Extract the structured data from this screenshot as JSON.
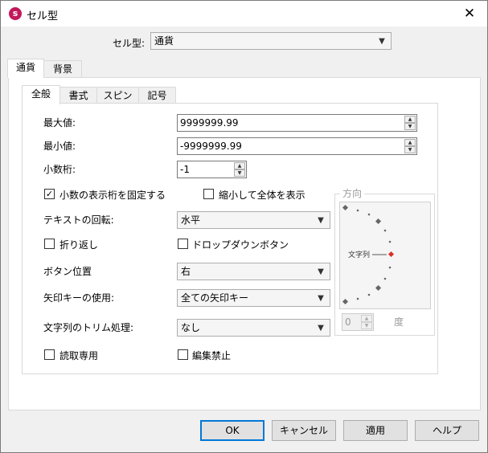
{
  "title": "セル型",
  "colors": {
    "accent": "#0078d7",
    "app_icon": "#c2185b",
    "marker_red": "#d93025"
  },
  "cell_type": {
    "label": "セル型:",
    "value": "通貨"
  },
  "outer_tabs": [
    {
      "label": "通貨"
    },
    {
      "label": "背景"
    }
  ],
  "inner_tabs": [
    {
      "label": "全般"
    },
    {
      "label": "書式"
    },
    {
      "label": "スピン"
    },
    {
      "label": "記号"
    }
  ],
  "fields": {
    "max_label": "最大値:",
    "max_value": "9999999.99",
    "min_label": "最小値:",
    "min_value": "-9999999.99",
    "decimal_label": "小数桁:",
    "decimal_value": "-1"
  },
  "checks": {
    "fixed_decimal": {
      "label": "小数の表示桁を固定する",
      "checked": true
    },
    "shrink_to_fit": {
      "label": "縮小して全体を表示",
      "checked": false
    },
    "wrap": {
      "label": "折り返し",
      "checked": false
    },
    "dropdown_button": {
      "label": "ドロップダウンボタン",
      "checked": false
    },
    "read_only": {
      "label": "読取専用",
      "checked": false
    },
    "edit_lock": {
      "label": "編集禁止",
      "checked": false
    }
  },
  "selects": {
    "rotation_label": "テキストの回転:",
    "rotation_value": "水平",
    "button_pos_label": "ボタン位置",
    "button_pos_value": "右",
    "arrow_keys_label": "矢印キーの使用:",
    "arrow_keys_value": "全ての矢印キー",
    "trim_label": "文字列のトリム処理:",
    "trim_value": "なし"
  },
  "orientation": {
    "group_label": "方向",
    "text_label": "文字列",
    "degree_value": "0",
    "degree_unit": "度"
  },
  "buttons": {
    "ok": "OK",
    "cancel": "キャンセル",
    "apply": "適用",
    "help": "ヘルプ"
  },
  "glyphs": {
    "close": "✕",
    "arrow_down": "▼",
    "arrow_up": "▲",
    "check": "✓"
  }
}
